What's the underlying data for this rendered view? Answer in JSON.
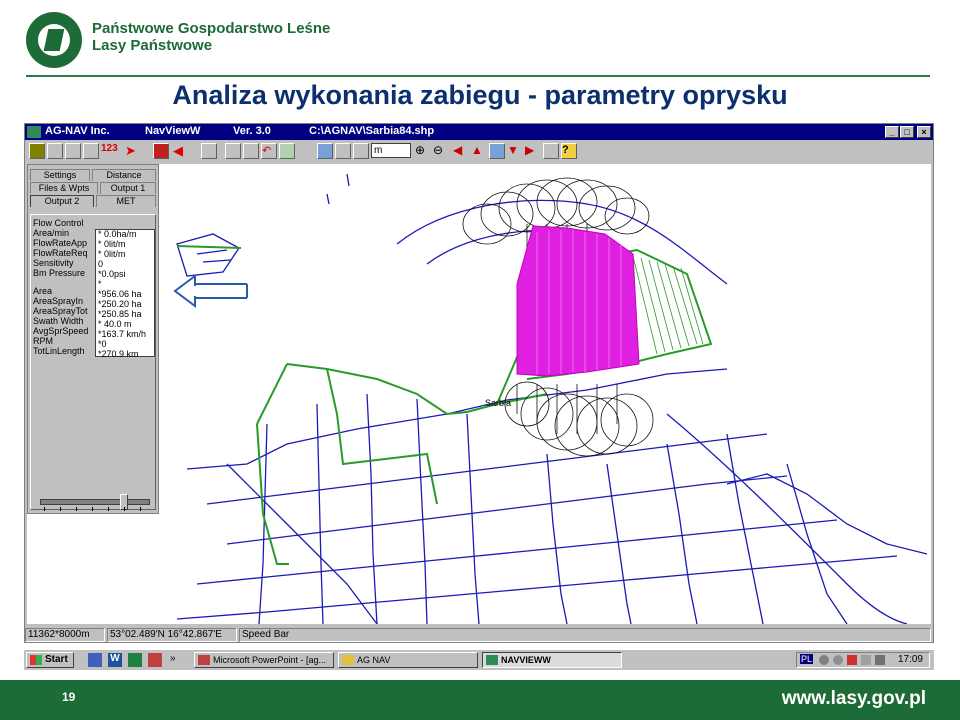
{
  "slide": {
    "organization_line1": "Państwowe Gospodarstwo Leśne",
    "organization_line2": "Lasy Państwowe",
    "logo_text": "LASY PAŃSTWOWE",
    "title": "Analiza wykonania zabiegu - parametry oprysku",
    "page_number": "19",
    "website": "www.lasy.gov.pl",
    "colors": {
      "brand_green": "#1d6b36",
      "title_blue": "#0c2f6e",
      "sprayed_area": "#e020e0",
      "route_green": "#2a9a2a",
      "roads": "#1a1ab8"
    }
  },
  "window": {
    "company": "AG-NAV Inc.",
    "app_name": "NavViewW",
    "version": "Ver. 3.0",
    "file_path": "C:\\AGNAV\\Sarbia84.shp",
    "buttons": [
      "minimize",
      "maximize",
      "close"
    ]
  },
  "toolbar": {
    "zoom_unit": "m",
    "icons": [
      "open-icon",
      "save-icon",
      "print-icon",
      "count-icon",
      "go-arrow-icon",
      "zoom-in-icon",
      "zoom-out-icon",
      "arrow-left-icon",
      "arrow-up-icon",
      "arrow-down-icon",
      "arrow-right-icon",
      "help-icon"
    ]
  },
  "panel": {
    "tabs": [
      "Settings",
      "Distance",
      "Files & Wpts",
      "Output 1",
      "Output 2",
      "MET"
    ],
    "labels": [
      "Flow Control",
      "Area/min",
      "FlowRateApp",
      "FlowRateReq",
      "Sensitivity",
      "Bm Pressure",
      "Area",
      "AreaSprayIn",
      "AreaSprayTot",
      "Swath Width",
      "AvgSprSpeed",
      "RPM",
      "TotLinLength"
    ],
    "values": [
      "* 0.0ha/m",
      "* 0lit/m",
      "* 0lit/m",
      "0",
      "*0.0psi",
      "*",
      "*956.06 ha",
      "*250.20 ha",
      "*250.85 ha",
      "* 40.0 m",
      "*163.7 km/h",
      "*0",
      "*270.9 km"
    ]
  },
  "map": {
    "place_label": "Sarbia"
  },
  "status": {
    "scale": "11362*8000m",
    "coords": "53°02.489'N 16°42.867'E",
    "speed": "Speed Bar"
  },
  "taskbar": {
    "start": "Start",
    "tasks": [
      "Microsoft PowerPoint - [ag...",
      "AG NAV",
      "NAVVIEWW"
    ],
    "tray_text": "PL",
    "clock": "17:09"
  }
}
